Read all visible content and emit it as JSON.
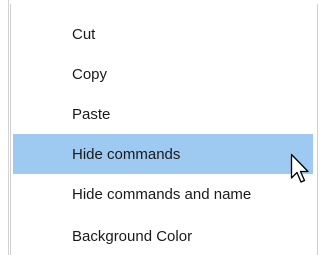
{
  "context_menu": {
    "items": [
      {
        "label": "Cut"
      },
      {
        "label": "Copy"
      },
      {
        "label": "Paste"
      },
      {
        "label": "Hide commands",
        "highlighted": true
      },
      {
        "label": "Hide commands and name"
      },
      {
        "label": "Background Color"
      }
    ],
    "highlight_color": "#9ec9f0"
  },
  "cursor": {
    "icon": "arrow-pointer-icon"
  }
}
